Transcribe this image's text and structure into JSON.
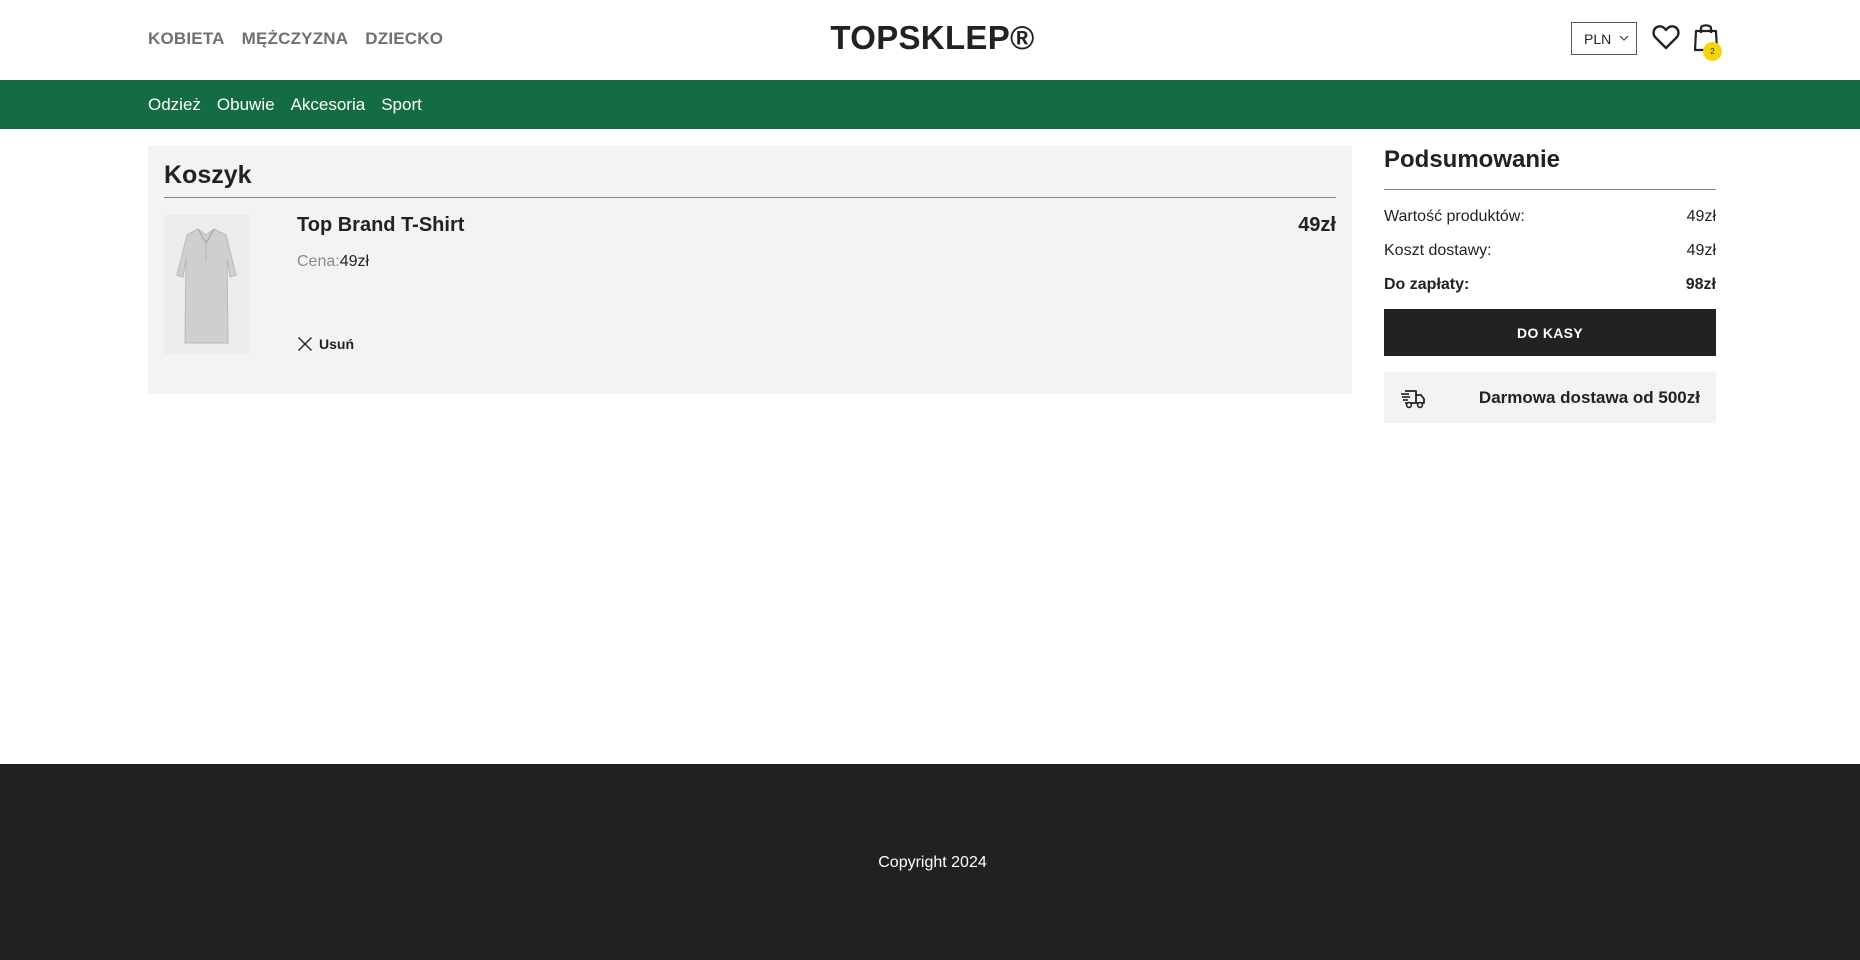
{
  "header": {
    "gender_nav": [
      "KOBIETA",
      "MĘŻCZYZNA",
      "DZIECKO"
    ],
    "logo": "TOPSKLEP®",
    "currency": "PLN",
    "cart_count": "2"
  },
  "categories": [
    "Odzież",
    "Obuwie",
    "Akcesoria",
    "Sport"
  ],
  "cart": {
    "title": "Koszyk",
    "items": [
      {
        "name": "Top Brand T-Shirt",
        "total": "49zł",
        "unit_label": "Cena:",
        "unit_price": "49zł",
        "remove_label": "Usuń"
      }
    ]
  },
  "summary": {
    "title": "Podsumowanie",
    "rows": [
      {
        "label": "Wartość produktów:",
        "value": "49zł"
      },
      {
        "label": "Koszt dostawy:",
        "value": "49zł"
      },
      {
        "label": "Do zapłaty:",
        "value": "98zł"
      }
    ],
    "checkout_label": "DO KASY",
    "delivery_text": "Darmowa dostawa od 500zł"
  },
  "footer": {
    "copyright": "Copyright 2024"
  },
  "colors": {
    "brand_green": "#146c43",
    "dark": "#222122",
    "badge": "#f5d40f",
    "panel": "#f3f3f3"
  },
  "icons": [
    "chevron-down-icon",
    "heart-icon",
    "shopping-bag-icon",
    "close-icon",
    "delivery-truck-icon"
  ]
}
